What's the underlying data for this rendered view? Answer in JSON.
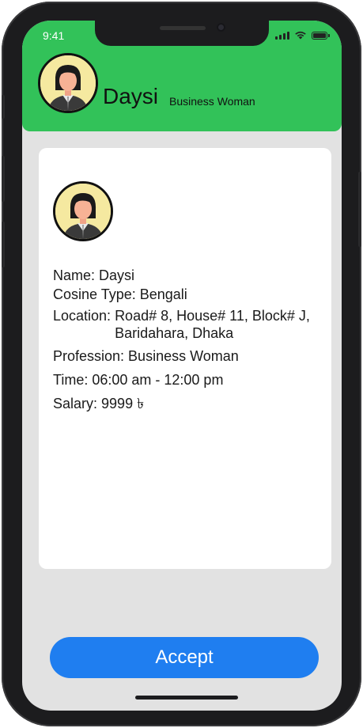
{
  "status_bar": {
    "time": "9:41"
  },
  "header": {
    "name": "Daysi",
    "role": "Business Woman"
  },
  "card": {
    "fields": [
      {
        "key": "Name:",
        "value": "Daysi"
      },
      {
        "key": "Cosine Type:",
        "value": "Bengali"
      },
      {
        "key": "Location:",
        "value": "Road# 8, House# 11, Block# J, Baridahara, Dhaka"
      },
      {
        "key": "Profession:",
        "value": "Business Woman"
      },
      {
        "key": "Time:",
        "value": "06:00 am - 12:00 pm"
      },
      {
        "key": "Salary:",
        "value": "9999 ৳"
      }
    ]
  },
  "actions": {
    "accept_label": "Accept"
  },
  "colors": {
    "header": "#32c259",
    "accept": "#1f7ef0",
    "background": "#e2e2e2"
  },
  "icons": {
    "avatar": "woman-avatar-icon",
    "signal": "signal-icon",
    "wifi": "wifi-icon",
    "battery": "battery-icon"
  }
}
